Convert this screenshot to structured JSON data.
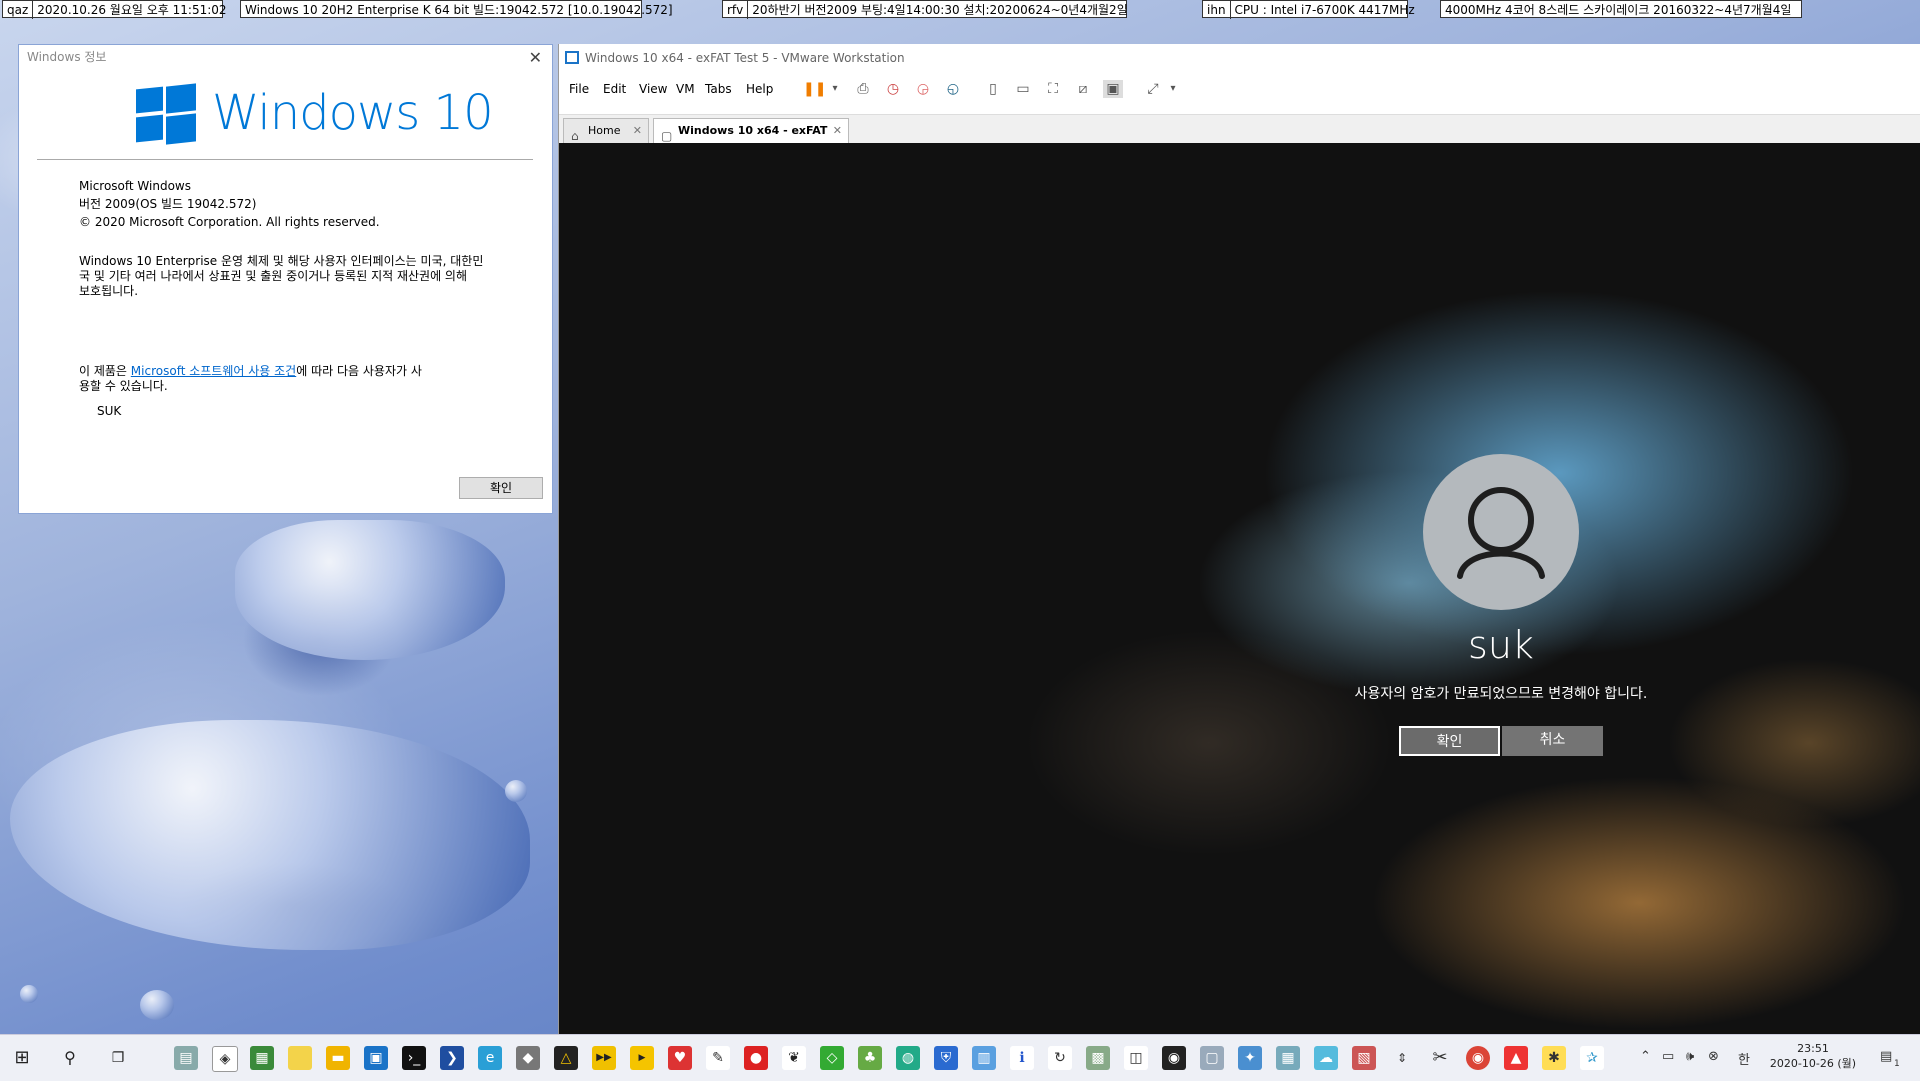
{
  "topbars": [
    {
      "label": "qaz",
      "text": "2020.10.26 월요일 오후 11:51:02"
    },
    {
      "label": "",
      "text": "Windows 10 20H2 Enterprise K 64 bit 빌드:19042.572 [10.0.19042.572]"
    },
    {
      "label": "rfv",
      "text": "20하반기 버전2009 부팅:4일14:00:30 설치:20200624~0년4개월2일"
    },
    {
      "label": "ihn",
      "text": "CPU : Intel i7-6700K 4417MHz"
    },
    {
      "label": "",
      "text": "4000MHz 4코어 8스레드 스카이레이크 20160322~4년7개월4일"
    }
  ],
  "about": {
    "title": "Windows 정보",
    "logo_text": "Windows 10",
    "product": "Microsoft Windows",
    "version": "버전 2009(OS 빌드 19042.572)",
    "copyright": "© 2020 Microsoft Corporation. All rights reserved.",
    "legal_line1": "Windows 10 Enterprise 운영 체제 및 해당 사용자 인터페이스는 미국, 대한민",
    "legal_line2": "국 및 기타 여러 나라에서 상표권 및 출원 중이거나 등록된 지적 재산권에 의해",
    "legal_line3": "보호됩니다.",
    "license_prefix": "이 제품은 ",
    "license_link": "Microsoft 소프트웨어 사용 조건",
    "license_suffix": "에 따라 다음 사용자가 사",
    "license_line2": "용할 수 있습니다.",
    "licensed_user": "SUK",
    "ok_button": "확인"
  },
  "vmware": {
    "title": "Windows 10 x64 - exFAT Test 5 - VMware Workstation",
    "menus": [
      "File",
      "Edit",
      "View",
      "VM",
      "Tabs",
      "Help"
    ],
    "tabs": [
      {
        "label": "Home",
        "active": false
      },
      {
        "label": "Windows 10 x64 - exFAT T...",
        "active": true
      }
    ]
  },
  "vm_screen": {
    "username": "suk",
    "message": "사용자의 암호가 만료되었으므로 변경해야 합니다.",
    "confirm_button": "확인",
    "cancel_button": "취소"
  },
  "taskbar": {
    "time": "23:51",
    "date": "2020-10-26 (월)",
    "ime": "한",
    "notification_count": "1"
  }
}
